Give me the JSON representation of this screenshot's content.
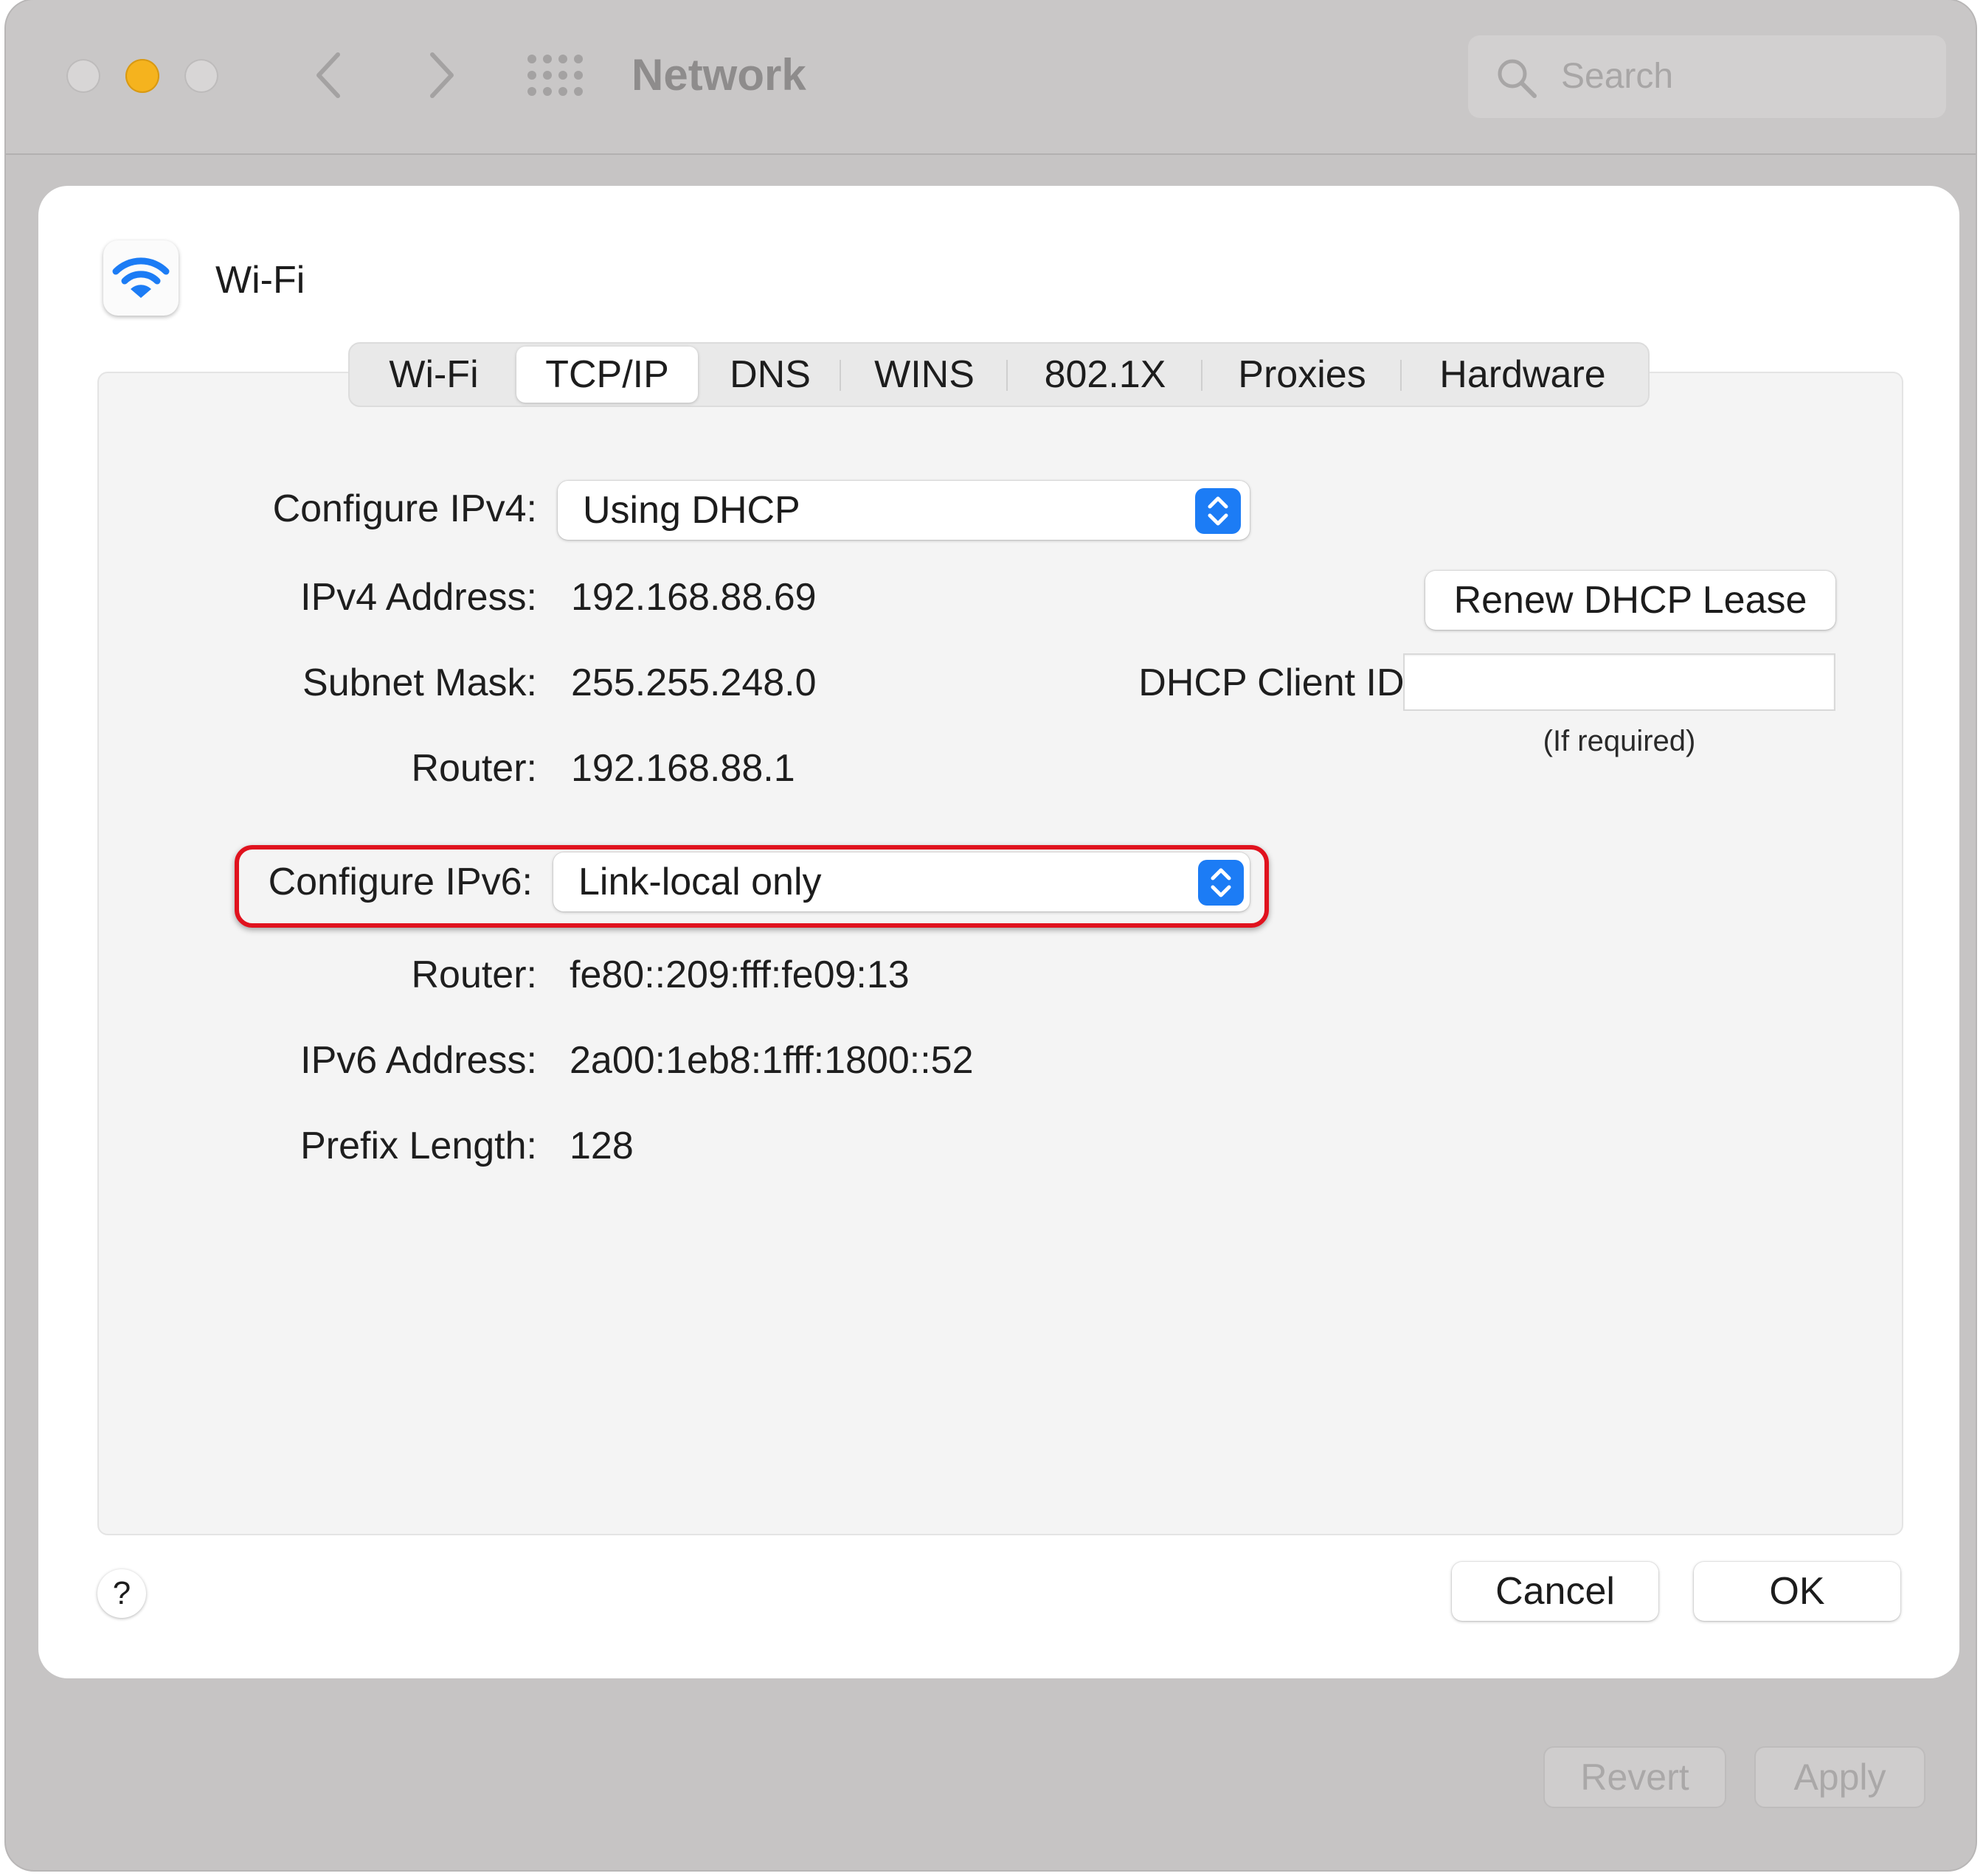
{
  "window": {
    "title": "Network",
    "search_placeholder": "Search",
    "revert_label": "Revert",
    "apply_label": "Apply"
  },
  "sheet": {
    "service_name": "Wi-Fi",
    "tabs": [
      {
        "label": "Wi-Fi"
      },
      {
        "label": "TCP/IP"
      },
      {
        "label": "DNS"
      },
      {
        "label": "WINS"
      },
      {
        "label": "802.1X"
      },
      {
        "label": "Proxies"
      },
      {
        "label": "Hardware"
      }
    ],
    "active_tab": "TCP/IP",
    "ipv4": {
      "configure_label": "Configure IPv4:",
      "configure_value": "Using DHCP",
      "address_label": "IPv4 Address:",
      "address_value": "192.168.88.69",
      "subnet_label": "Subnet Mask:",
      "subnet_value": "255.255.248.0",
      "router_label": "Router:",
      "router_value": "192.168.88.1",
      "renew_button": "Renew DHCP Lease",
      "client_id_label": "DHCP Client ID:",
      "client_id_value": "",
      "client_id_hint": "(If required)"
    },
    "ipv6": {
      "configure_label": "Configure IPv6:",
      "configure_value": "Link-local only",
      "router_label": "Router:",
      "router_value": "fe80::209:fff:fe09:13",
      "address_label": "IPv6 Address:",
      "address_value": "2a00:1eb8:1fff:1800::52",
      "prefix_label": "Prefix Length:",
      "prefix_value": "128"
    },
    "help_label": "?",
    "cancel_label": "Cancel",
    "ok_label": "OK"
  },
  "colors": {
    "accent": "#1c7cf5",
    "highlight_red": "#e0121e",
    "minimize_yellow": "#f5b31e"
  },
  "icons": {
    "wifi": "wifi-icon",
    "search": "search-icon",
    "back": "chevron-left-icon",
    "forward": "chevron-right-icon",
    "show_all": "grid-icon",
    "stepper": "up-down-chevron-icon"
  }
}
